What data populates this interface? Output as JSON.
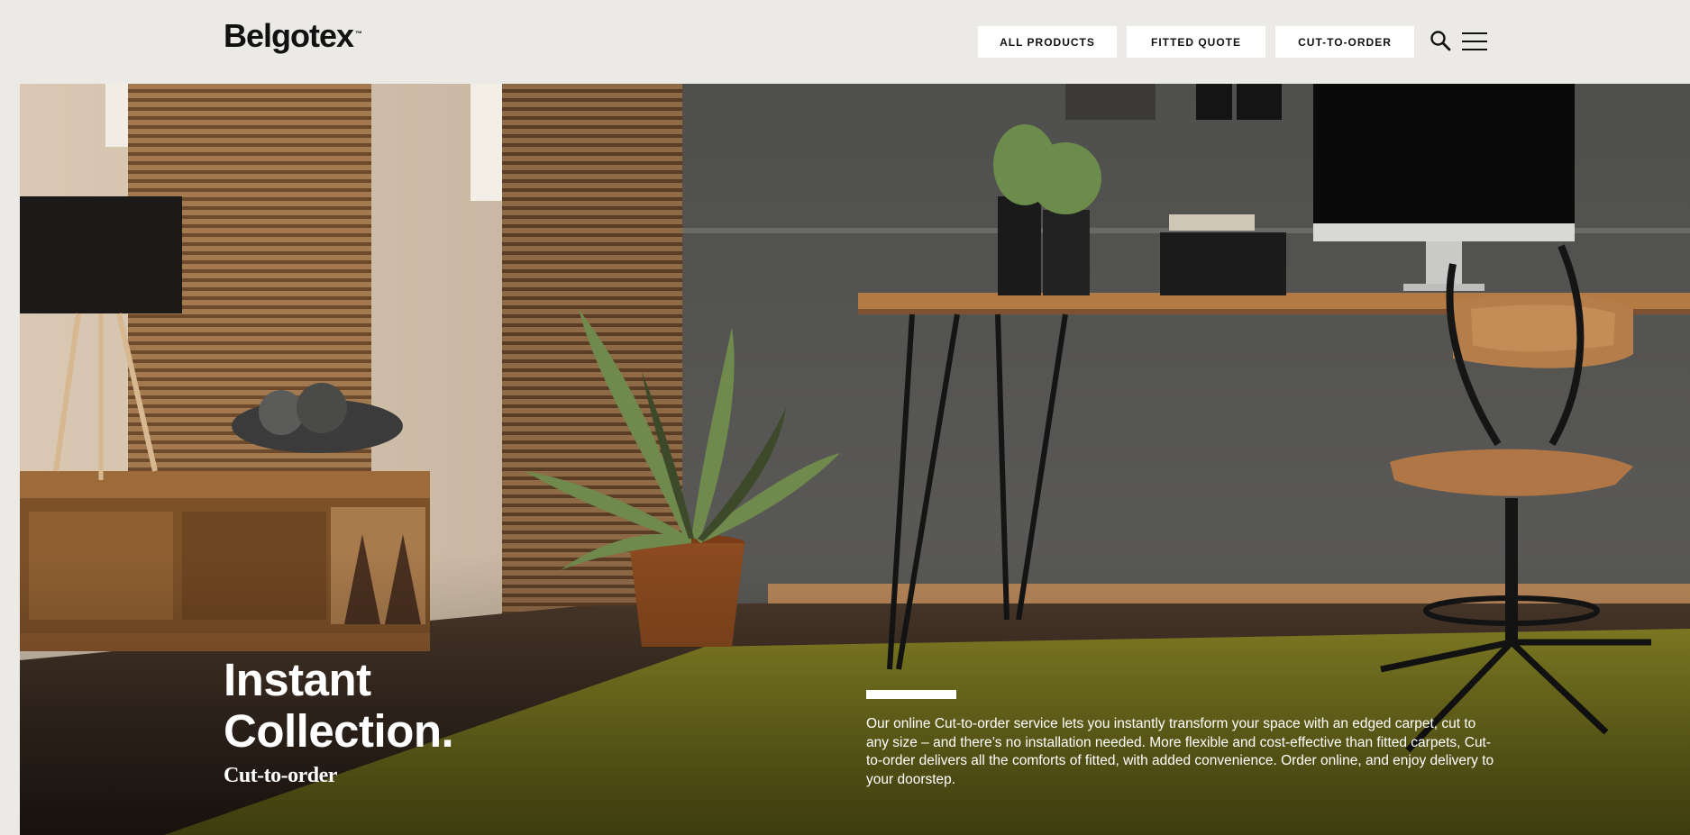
{
  "header": {
    "logo": "Belgotex",
    "logo_tm": "™",
    "nav": {
      "all_products": "ALL PRODUCTS",
      "fitted_quote": "FITTED QUOTE",
      "cut_to_order": "CUT-TO-ORDER"
    },
    "icons": {
      "search": "search-icon",
      "menu": "hamburger-menu-icon"
    }
  },
  "hero": {
    "title_line1": "Instant",
    "title_line2": "Collection.",
    "subtitle": "Cut-to-order",
    "description": "Our online Cut-to-order service lets you instantly transform your space with an edged carpet, cut to any size – and there’s no installation needed. More flexible and cost-effective than fitted carpets, Cut-to-order delivers all the comforts of fitted, with added convenience. Order online, and enjoy delivery to your doorstep.",
    "accent_color": "#ffffff",
    "carpet_color": "#7f7d20"
  }
}
